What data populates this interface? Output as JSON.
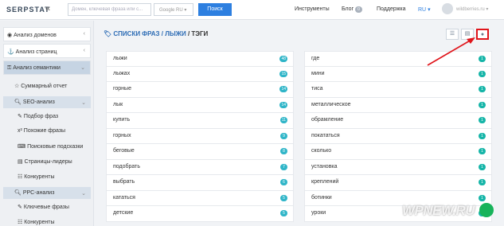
{
  "header": {
    "logo": "SERPSTAT",
    "collapse": "«",
    "search_placeholder": "Домен, ключевая фраза или с...",
    "database": "Google RU",
    "search_button": "Поиск",
    "tools": "Инструменты",
    "blog": "Блог",
    "blog_count": "0",
    "support": "Поддержка",
    "lang": "RU",
    "username": "wildberries.ru"
  },
  "sidebar": {
    "domain_analysis": "Анализ доменов",
    "page_analysis": "Анализ страниц",
    "semantic_analysis": "Анализ семантики",
    "summary": "Суммарный отчет",
    "seo": "SEO-анализ",
    "phrase_selection": "Подбор фраз",
    "similar": "Похожие фразы",
    "hints": "Поисковые подсказки",
    "leaders": "Страницы-лидеры",
    "competitors": "Конкуренты",
    "ppc": "PPC-анализ",
    "keywords": "Ключевые фразы",
    "competitors2": "Конкуренты"
  },
  "breadcrumb": {
    "lists": "СПИСКИ ФРАЗ",
    "sep1": "/",
    "skis": "ЛЫЖИ",
    "sep2": "/",
    "tags": "ТЭГИ"
  },
  "left_rows": [
    {
      "word": "лыжи",
      "count": "48"
    },
    {
      "word": "лыжах",
      "count": "15"
    },
    {
      "word": "горные",
      "count": "14"
    },
    {
      "word": "лык",
      "count": "14"
    },
    {
      "word": "купить",
      "count": "11"
    },
    {
      "word": "горных",
      "count": "9"
    },
    {
      "word": "беговые",
      "count": "8"
    },
    {
      "word": "подобрать",
      "count": "7"
    },
    {
      "word": "выбрать",
      "count": "6"
    },
    {
      "word": "кататься",
      "count": "5"
    },
    {
      "word": "детские",
      "count": "5"
    }
  ],
  "right_rows": [
    {
      "word": "где",
      "count": "1"
    },
    {
      "word": "мини",
      "count": "1"
    },
    {
      "word": "тиса",
      "count": "1"
    },
    {
      "word": "металлическое",
      "count": "1"
    },
    {
      "word": "обрамление",
      "count": "1"
    },
    {
      "word": "покататься",
      "count": "1"
    },
    {
      "word": "сколько",
      "count": "1"
    },
    {
      "word": "установка",
      "count": "1"
    },
    {
      "word": "креплений",
      "count": "1"
    },
    {
      "word": "ботинки",
      "count": "1"
    },
    {
      "word": "уроки",
      "count": "1"
    }
  ],
  "watermark": "WPNEW.RU",
  "colors": {
    "accent": "#2d7fe0",
    "highlight": "#e0151b",
    "badge": "#2fb5c8"
  }
}
